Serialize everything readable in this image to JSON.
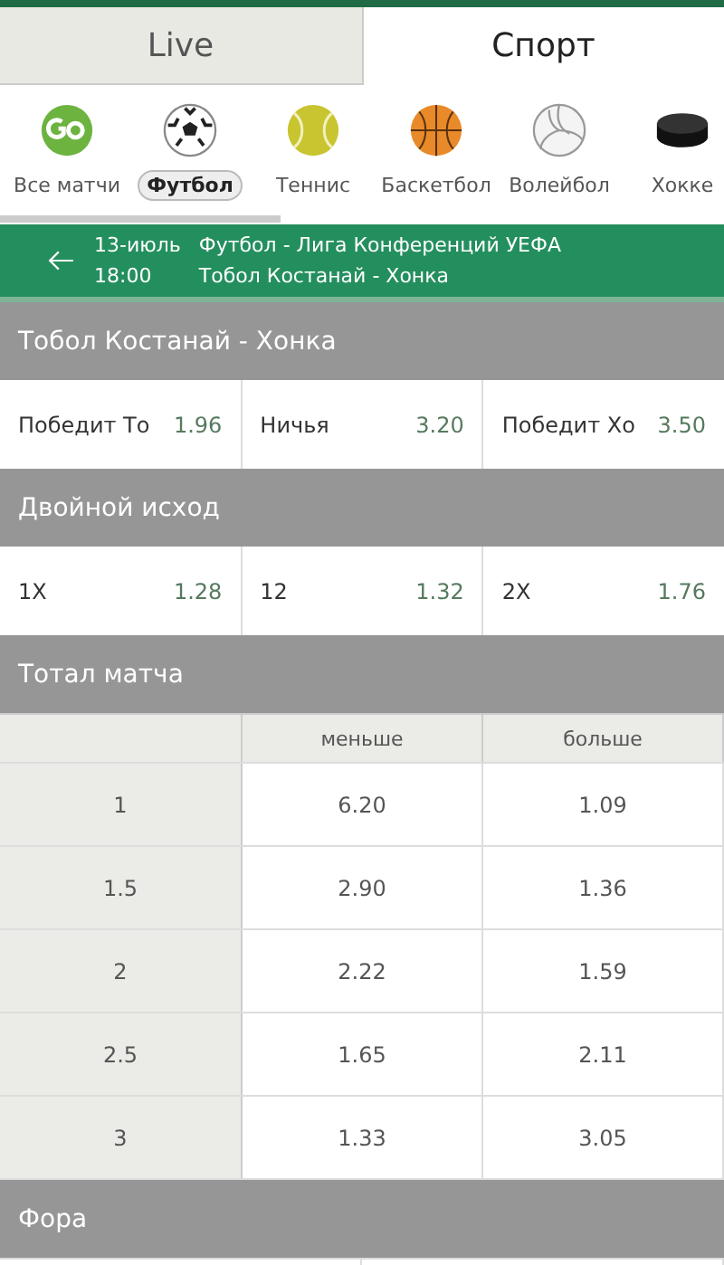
{
  "tabs": [
    {
      "label": "Live",
      "selected": false
    },
    {
      "label": "Спорт",
      "selected": true
    }
  ],
  "sports": [
    {
      "kind": "go",
      "label": "Все матчи",
      "selected": false
    },
    {
      "kind": "football",
      "label": "Футбол",
      "selected": true
    },
    {
      "kind": "tennis",
      "label": "Теннис",
      "selected": false
    },
    {
      "kind": "basketball",
      "label": "Баскетбол",
      "selected": false
    },
    {
      "kind": "volleyball",
      "label": "Волейбол",
      "selected": false
    },
    {
      "kind": "hockey",
      "label": "Хокке",
      "selected": false
    }
  ],
  "event": {
    "date": "13-июль",
    "time": "18:00",
    "league": "Футбол - Лига Конференций УЕФА",
    "match": "Тобол Костанай - Хонка"
  },
  "markets": [
    {
      "kind": "row",
      "title": "Тобол Костанай - Хонка",
      "outcomes": [
        {
          "label": "Победит То",
          "odds": "1.96"
        },
        {
          "label": "Ничья",
          "odds": "3.20"
        },
        {
          "label": "Победит Хо",
          "odds": "3.50"
        }
      ]
    },
    {
      "kind": "row",
      "title": "Двойной исход",
      "outcomes": [
        {
          "label": "1X",
          "odds": "1.28"
        },
        {
          "label": "12",
          "odds": "1.32"
        },
        {
          "label": "2X",
          "odds": "1.76"
        }
      ]
    },
    {
      "kind": "table",
      "title": "Тотал матча",
      "columns": [
        "меньше",
        "больше"
      ],
      "rows": [
        {
          "line": "1",
          "odds": [
            "6.20",
            "1.09"
          ]
        },
        {
          "line": "1.5",
          "odds": [
            "2.90",
            "1.36"
          ]
        },
        {
          "line": "2",
          "odds": [
            "2.22",
            "1.59"
          ]
        },
        {
          "line": "2.5",
          "odds": [
            "1.65",
            "2.11"
          ]
        },
        {
          "line": "3",
          "odds": [
            "1.33",
            "3.05"
          ]
        }
      ]
    },
    {
      "kind": "empty",
      "title": "Фора"
    }
  ]
}
